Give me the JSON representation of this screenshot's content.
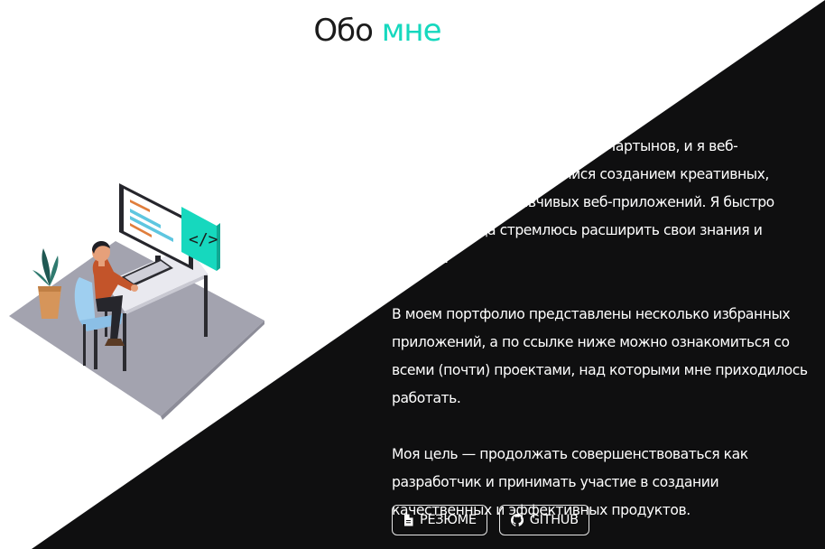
{
  "header": {
    "title_main": "Обо",
    "title_accent": "мне"
  },
  "about": {
    "paragraphs": [
      "Привет! Меня зовут Дмитрий Мартынов, и я веб-разработчик, увлекающийся созданием креативных, практичных и отзывчивых веб-приложений. Я быстро учусь и всегда стремлюсь расширить свои знания и навыки.",
      "В моем портфолио представлены несколько избранных приложений, а по ссылке ниже можно ознакомиться со всеми (почти) проектами, над которыми мне приходилось работать.",
      "Моя цель — продолжать совершенствоваться как разработчик и принимать участие в создании качественных и эффективных продуктов."
    ]
  },
  "buttons": {
    "resume_label": "РЕЗЮМЕ",
    "resume_icon": "document-icon",
    "github_label": "GITHUB",
    "github_icon": "github-icon"
  },
  "colors": {
    "accent": "#16d8be",
    "dark": "#0f0f10",
    "text_dark": "#1b1b1b"
  }
}
